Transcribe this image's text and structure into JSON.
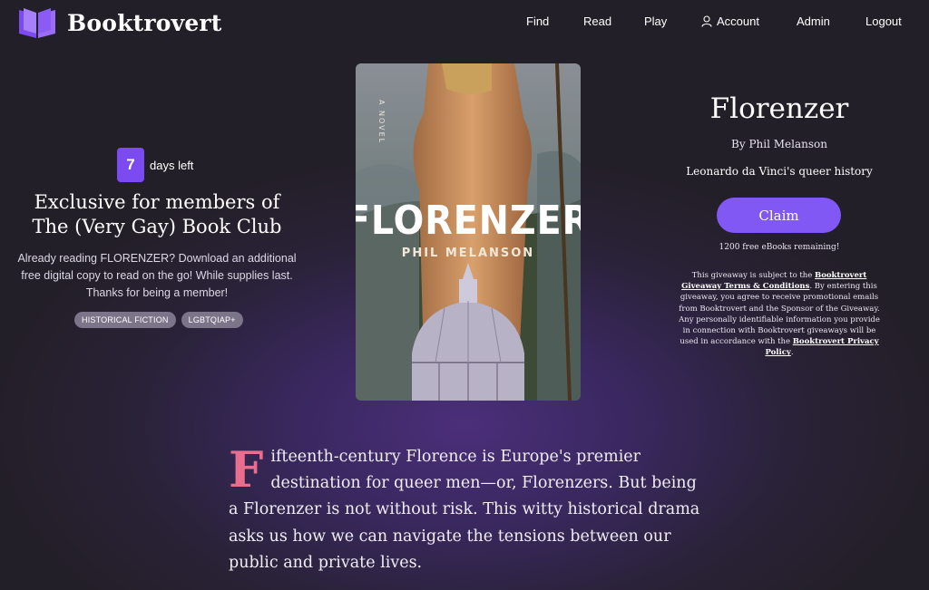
{
  "brand": {
    "name": "Booktrovert",
    "logo_icon": "open-book-icon",
    "accent": "#7b4af0"
  },
  "nav": {
    "find": "Find",
    "read": "Read",
    "play": "Play",
    "account": "Account",
    "admin": "Admin",
    "logout": "Logout"
  },
  "promo": {
    "days_count": "7",
    "days_label": "days left",
    "headline_line1": "Exclusive for members of",
    "headline_line2": "The (Very Gay) Book Club",
    "description": "Already reading FLORENZER? Download an additional free digital copy to read on the go! While supplies last. Thanks for being a member!",
    "tags": [
      "HISTORICAL FICTION",
      "LGBTQIAP+"
    ]
  },
  "cover": {
    "kicker": "A NOVEL",
    "title": "FLORENZER",
    "author": "PHIL MELANSON"
  },
  "book": {
    "title": "Florenzer",
    "author_line": "By Phil Melanson",
    "subtitle": "Leonardo da Vinci's queer history",
    "claim_label": "Claim",
    "remaining": "1200 free eBooks remaining!"
  },
  "legal": {
    "part1": "This giveaway is subject to the ",
    "link1": "Booktrovert Giveaway Terms & Conditions",
    "part2": ". By entering this giveaway, you agree to receive promotional emails from Booktrovert and the Sponsor of the Giveaway. Any personally identifiable information you provide in connection with Booktrovert giveaways will be used in accordance with the ",
    "link2": "Booktrovert Privacy Policy",
    "part3": "."
  },
  "blurb": {
    "dropcap": "F",
    "text": "ifteenth-century Florence is Europe's premier destination for queer men—or, Florenzers. But being a Florenzer is not without risk. This witty historical drama asks us how we can navigate the tensions between our public and private lives."
  }
}
